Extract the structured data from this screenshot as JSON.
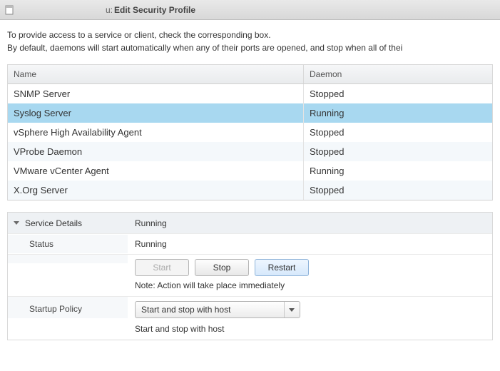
{
  "titlebar": {
    "fragment": "u:",
    "title": "Edit Security Profile"
  },
  "intro": {
    "line1": "To provide access to a service or client, check the corresponding box.",
    "line2": "By default, daemons will start automatically when any of their ports are opened, and stop when all of thei"
  },
  "table": {
    "headers": {
      "name": "Name",
      "daemon": "Daemon"
    },
    "rows": [
      {
        "name": "SNMP Server",
        "daemon": "Stopped",
        "selected": false
      },
      {
        "name": "Syslog Server",
        "daemon": "Running",
        "selected": true
      },
      {
        "name": "vSphere High Availability Agent",
        "daemon": "Stopped",
        "selected": false
      },
      {
        "name": "VProbe Daemon",
        "daemon": "Stopped",
        "selected": false
      },
      {
        "name": "VMware vCenter Agent",
        "daemon": "Running",
        "selected": false
      },
      {
        "name": "X.Org Server",
        "daemon": "Stopped",
        "selected": false
      }
    ]
  },
  "details": {
    "header_label": "Service Details",
    "header_value": "Running",
    "status_label": "Status",
    "status_value": "Running",
    "buttons": {
      "start": "Start",
      "stop": "Stop",
      "restart": "Restart"
    },
    "note": "Note: Action will take place immediately",
    "policy_label": "Startup Policy",
    "policy_selected": "Start and stop with host",
    "policy_desc": "Start and stop with host"
  }
}
